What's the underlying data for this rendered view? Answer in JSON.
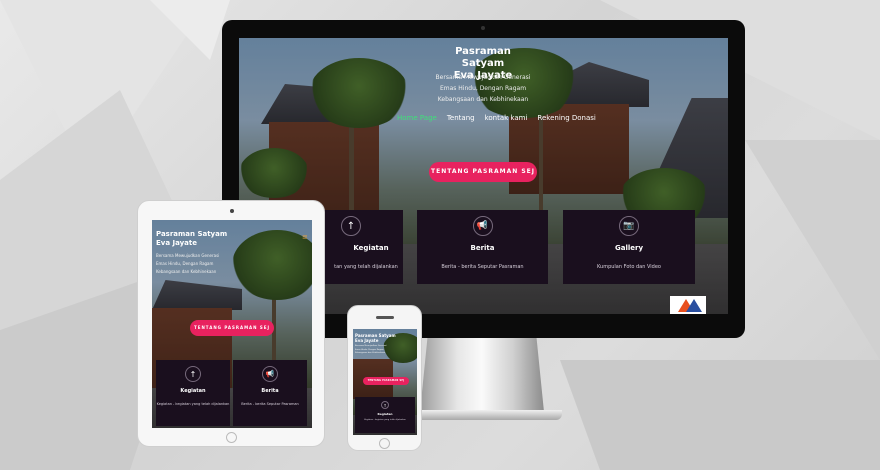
{
  "site": {
    "title_line1": "Pasraman Satyam",
    "title_line2": "Eva Jayate",
    "tagline_line1": "Bersama Mewujudkan Generasi",
    "tagline_line2": "Emas Hindu, Dengan Ragam",
    "tagline_line3": "Kebangsaan dan Kebhinekaan",
    "nav": [
      {
        "label": "Home Page",
        "active": true
      },
      {
        "label": "Tentang",
        "active": false
      },
      {
        "label": "kontak kami",
        "active": false
      },
      {
        "label": "Rekening Donasi",
        "active": false
      }
    ],
    "cta_label": "TENTANG PASRAMAN SEJ"
  },
  "cards": [
    {
      "icon": "arrow-up-icon",
      "title": "Kegiatan",
      "desc": "Kegiatan - kegiatan yang telah dijalankan",
      "desc_short": "tan yang telah dijalankan"
    },
    {
      "icon": "megaphone-icon",
      "title": "Berita",
      "desc": "Berita - berita Seputar Pasraman"
    },
    {
      "icon": "camera-icon",
      "title": "Gallery",
      "desc": "Kumpulan Foto dan Video"
    }
  ],
  "tablet": {
    "tagline_line3": "Kebangsaan dan Kebhinekaan",
    "card1_title": "Kegiatan",
    "card1_desc": "Kegiatan - kegiatan yang telah dijalankan"
  },
  "colors": {
    "accent": "#e8225f",
    "card_bg": "#1a0f1e",
    "nav_active": "#3fe07a"
  }
}
